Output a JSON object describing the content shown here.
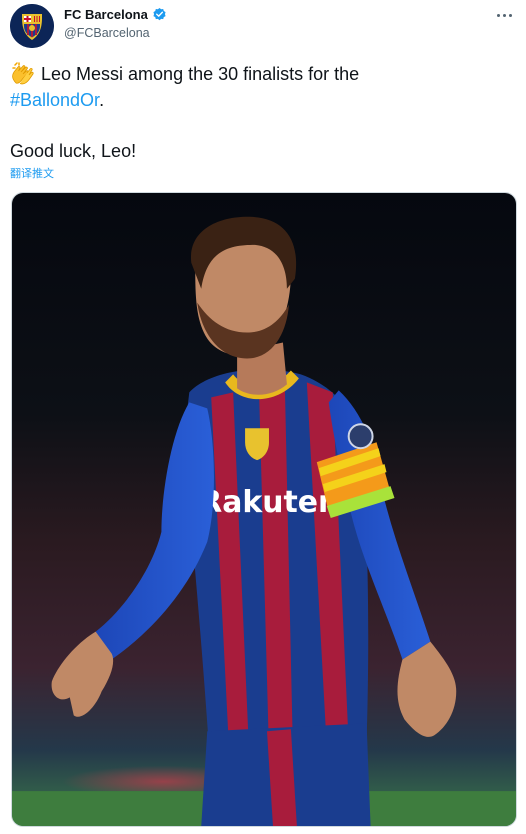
{
  "account": {
    "display_name": "FC Barcelona",
    "handle": "@FCBarcelona",
    "verified": true,
    "avatar_icon": "fc-barcelona-crest-icon"
  },
  "tweet": {
    "emoji_icon": "clapping-hands-icon",
    "line1": "Leo Messi among the 30 finalists for the",
    "hashtag": "#BallondOr",
    "hashtag_suffix": ".",
    "line3": "Good luck, Leo!",
    "translate_label": "翻译推文"
  },
  "media": {
    "type": "photo",
    "jersey_sponsor": "Rakuten"
  },
  "colors": {
    "link": "#1d9bf0",
    "verified": "#1d9bf0",
    "secondary_text": "#536471",
    "barca_blue": "#1a3d8f",
    "barca_red": "#a81c3c"
  }
}
